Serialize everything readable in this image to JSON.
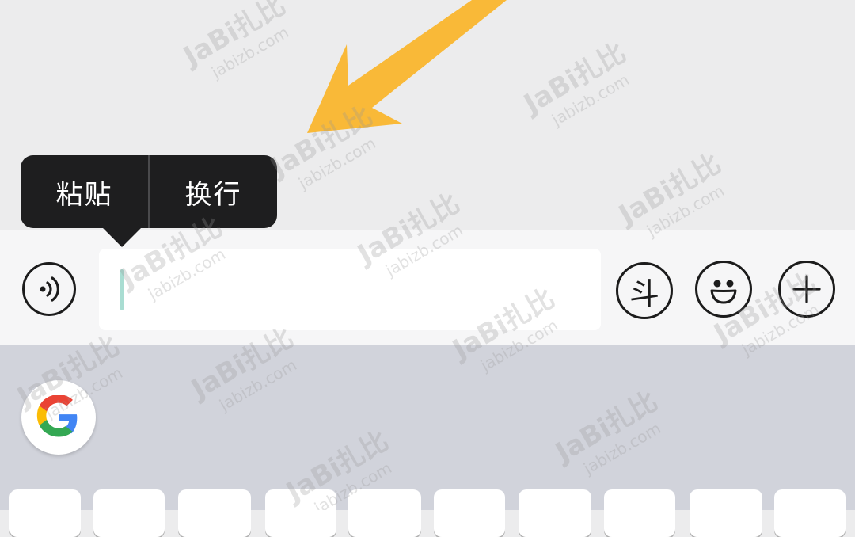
{
  "context_menu": {
    "items": [
      "粘贴",
      "换行"
    ]
  },
  "input_bar": {
    "voice_icon": "voice-wave-icon",
    "sticker_icon_glyph": "斗",
    "emoji_icon": "smiley-icon",
    "more_icon": "plus-icon",
    "text_value": ""
  },
  "keyboard": {
    "suggestion_icon": "google-icon"
  },
  "watermark": {
    "brand": "JaBi扎比",
    "domain": "jabizb.com"
  },
  "colors": {
    "arrow": "#f9b938",
    "popup": "#1e1e1f",
    "keyboard": "#d1d3db",
    "caret": "#a9ddd2"
  }
}
